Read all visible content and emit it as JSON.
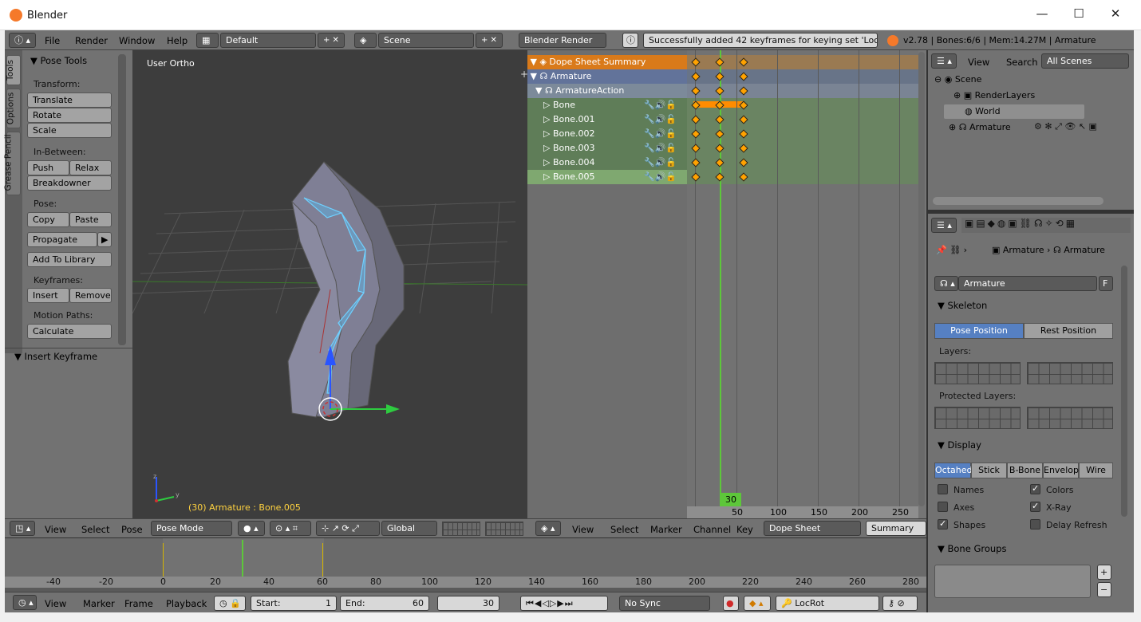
{
  "window": {
    "title": "Blender",
    "min": "—",
    "max": "☐",
    "close": "✕"
  },
  "info": {
    "menus": [
      "File",
      "Render",
      "Window",
      "Help"
    ],
    "layout": "Default",
    "scene": "Scene",
    "engine": "Blender Render",
    "message": "Successfully added 42 keyframes for keying set 'LocRot'",
    "stats": "v2.78 | Bones:6/6 | Mem:14.27M | Armature"
  },
  "tools": {
    "tabs": [
      "Tools",
      "Options",
      "Grease Pencil"
    ],
    "title": "Pose Tools",
    "transform": "Transform:",
    "translate": "Translate",
    "rotate": "Rotate",
    "scale": "Scale",
    "inbetween": "In-Between:",
    "push": "Push",
    "relax": "Relax",
    "breakdowner": "Breakdowner",
    "pose": "Pose:",
    "copy": "Copy",
    "paste": "Paste",
    "propagate": "Propagate",
    "add_library": "Add To Library",
    "keyframes": "Keyframes:",
    "insert": "Insert",
    "remove": "Remove",
    "motion_paths": "Motion Paths:",
    "calculate": "Calculate",
    "insert_keyframe": "Insert Keyframe"
  },
  "viewport": {
    "label": "User Ortho",
    "status": "(30) Armature : Bone.005",
    "axis_z": "z",
    "axis_y": "y",
    "menus": [
      "View",
      "Select",
      "Pose"
    ],
    "mode": "Pose Mode",
    "orientation": "Global"
  },
  "dope": {
    "summary": "Dope Sheet Summary",
    "armature": "Armature",
    "action": "ArmatureAction",
    "bones": [
      "Bone",
      "Bone.001",
      "Bone.002",
      "Bone.003",
      "Bone.004",
      "Bone.005"
    ],
    "current_frame": "30",
    "ticks": [
      "50",
      "100",
      "150",
      "200",
      "250"
    ],
    "menus": [
      "View",
      "Select",
      "Marker",
      "Channel",
      "Key"
    ],
    "mode": "Dope Sheet",
    "summary_btn": "Summary"
  },
  "outliner": {
    "view": "View",
    "search": "Search",
    "filter": "All Scenes",
    "items": [
      "Scene",
      "RenderLayers",
      "World",
      "Armature"
    ]
  },
  "props": {
    "breadcrumb1": "Armature",
    "breadcrumb2": "Armature",
    "name": "Armature",
    "f": "F",
    "skeleton": "Skeleton",
    "pose_position": "Pose Position",
    "rest_position": "Rest Position",
    "layers": "Layers:",
    "protected_layers": "Protected Layers:",
    "display": "Display",
    "display_modes": [
      "Octahed",
      "Stick",
      "B-Bone",
      "Envelop",
      "Wire"
    ],
    "names": "Names",
    "colors": "Colors",
    "axes": "Axes",
    "xray": "X-Ray",
    "shapes": "Shapes",
    "delay_refresh": "Delay Refresh",
    "bone_groups": "Bone Groups"
  },
  "timeline": {
    "ticks": [
      "-40",
      "-20",
      "0",
      "20",
      "40",
      "60",
      "80",
      "100",
      "120",
      "140",
      "160",
      "180",
      "200",
      "220",
      "240",
      "260",
      "280"
    ],
    "menus": [
      "View",
      "Marker",
      "Frame",
      "Playback"
    ],
    "start_label": "Start:",
    "start": "1",
    "end_label": "End:",
    "end": "60",
    "current": "30",
    "sync": "No Sync",
    "keying_set": "LocRot"
  },
  "colors": {
    "accent": "#ffa200",
    "selected": "#5680c2",
    "frame": "#5dc73a"
  }
}
